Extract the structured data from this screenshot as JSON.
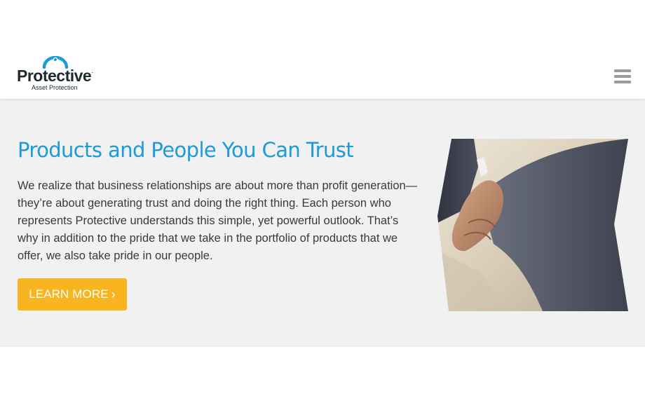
{
  "header": {
    "logo": {
      "wordmark": "Protective",
      "trademark": ".",
      "subtitle": "Asset Protection",
      "arc_color": "#1d9bd7"
    },
    "menu_icon": "hamburger-menu-icon"
  },
  "hero": {
    "title": "Products and People You Can Trust",
    "body": "We realize that business relationships are about more than profit generation—they’re about generating trust and doing the right thing. Each person who represents Protective understands this simple, yet powerful outlook. That’s why in addition to the pride that we take in the portfolio of products that we offer, we also take pride in our people.",
    "cta": {
      "label": "LEARN MORE",
      "chevron": "›"
    },
    "image": "handshake-photo"
  },
  "colors": {
    "accent_blue": "#1d9bd7",
    "cta_yellow": "#f8b520",
    "hero_background": "#f1f1f1",
    "body_text": "#3a3a3a"
  }
}
